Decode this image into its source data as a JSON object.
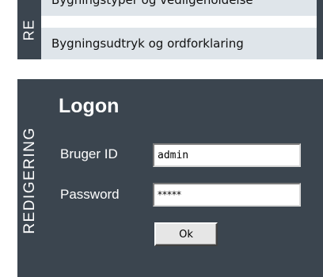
{
  "menu": {
    "section_label": "RE",
    "items": [
      {
        "label": "Bygningstyper og vedligeholdelse"
      },
      {
        "label": "Bygningsudtryk og ordforklaring"
      }
    ]
  },
  "login_panel": {
    "section_label": "REDIGERING",
    "title": "Logon",
    "user_id_label": "Bruger ID",
    "user_id_value": "admin",
    "password_label": "Password",
    "password_value": "*****",
    "ok_label": "Ok"
  },
  "colors": {
    "panel_bg": "#3b454f",
    "menu_item_bg": "#dfe5ea"
  }
}
